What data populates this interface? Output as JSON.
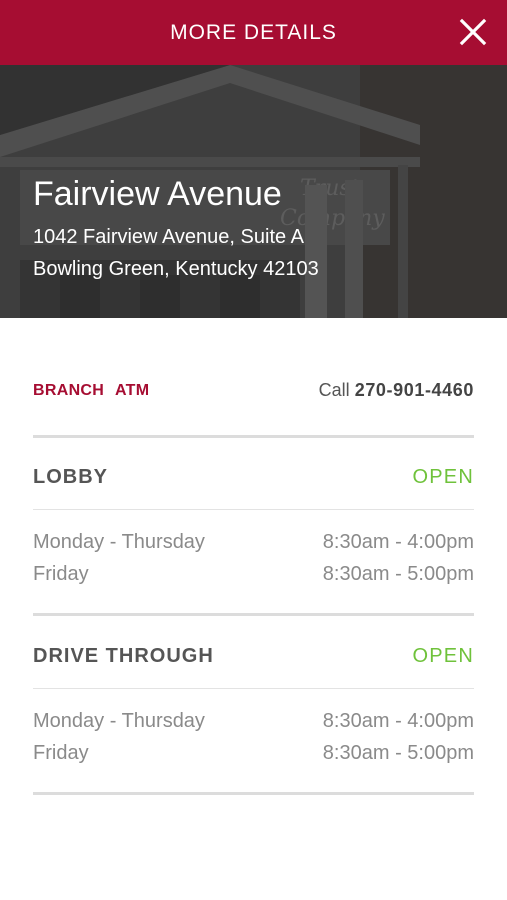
{
  "header": {
    "title": "MORE DETAILS",
    "close_icon": "close-icon"
  },
  "location": {
    "name": "Fairview Avenue",
    "address_line1": "1042 Fairview Avenue, Suite A",
    "address_line2": "Bowling Green, Kentucky 42103"
  },
  "tabs": [
    {
      "label": "BRANCH"
    },
    {
      "label": "ATM"
    }
  ],
  "call": {
    "prefix": "Call",
    "number": "270-901-4460"
  },
  "sections": [
    {
      "title": "LOBBY",
      "status": "OPEN",
      "hours": [
        {
          "days": "Monday - Thursday",
          "time": "8:30am - 4:00pm"
        },
        {
          "days": "Friday",
          "time": "8:30am - 5:00pm"
        }
      ]
    },
    {
      "title": "DRIVE THROUGH",
      "status": "OPEN",
      "hours": [
        {
          "days": "Monday - Thursday",
          "time": "8:30am - 4:00pm"
        },
        {
          "days": "Friday",
          "time": "8:30am - 5:00pm"
        }
      ]
    }
  ],
  "colors": {
    "brand": "#a60d32",
    "open": "#6fc23b"
  }
}
